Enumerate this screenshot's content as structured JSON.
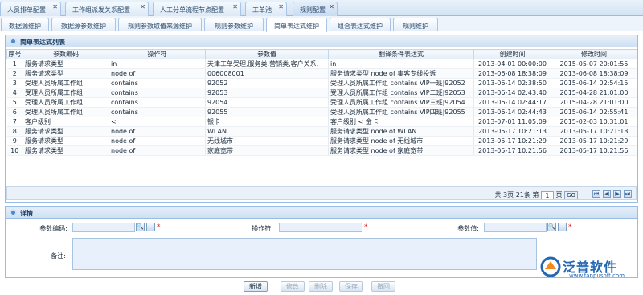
{
  "top_tabs": [
    {
      "label": "人员排单配置"
    },
    {
      "label": "工作组派发关系配置"
    },
    {
      "label": "人工分单流程节点配置"
    },
    {
      "label": "工单池"
    },
    {
      "label": "规则配置"
    }
  ],
  "sub_tabs": [
    {
      "label": "数据源维护"
    },
    {
      "label": "数据源参数维护"
    },
    {
      "label": "规则参数取值来源维护"
    },
    {
      "label": "规则参数维护"
    },
    {
      "label": "简单表达式维护"
    },
    {
      "label": "组合表达式维护"
    },
    {
      "label": "规则维护"
    }
  ],
  "list_panel": {
    "title": "简单表达式列表"
  },
  "table": {
    "columns": [
      "序号",
      "参数编码",
      "操作符",
      "参数值",
      "翻译条件表达式",
      "创建时间",
      "修改时间"
    ],
    "rows": [
      [
        "1",
        "服务请求类型",
        "in",
        "天津工单受理,服务类,营销类,客户关系,",
        "in",
        "2013-04-01 00:00:00",
        "2015-05-07 20:01:55"
      ],
      [
        "2",
        "服务请求类型",
        "node of",
        "006008001",
        "服务请求类型 node of 集客专线投诉",
        "2013-06-08 18:38:09",
        "2013-06-08 18:38:09"
      ],
      [
        "3",
        "受理人员所属工作组",
        "contains",
        "92052",
        "受理人员所属工作组 contains VIP一班|92052",
        "2013-06-14 02:38:50",
        "2015-06-14 02:54:15"
      ],
      [
        "4",
        "受理人员所属工作组",
        "contains",
        "92053",
        "受理人员所属工作组 contains VIP二班|92053",
        "2013-06-14 02:43:40",
        "2015-04-28 21:01:00"
      ],
      [
        "5",
        "受理人员所属工作组",
        "contains",
        "92054",
        "受理人员所属工作组 contains VIP三班|92054",
        "2013-06-14 02:44:17",
        "2015-04-28 21:01:00"
      ],
      [
        "6",
        "受理人员所属工作组",
        "contains",
        "92055",
        "受理人员所属工作组 contains VIP四班|92055",
        "2013-06-14 02:44:43",
        "2015-06-14 02:55:41"
      ],
      [
        "7",
        "客户级别",
        "<",
        "银卡",
        "客户级别 < 金卡",
        "2013-07-01 11:05:09",
        "2015-02-03 10:31:01"
      ],
      [
        "8",
        "服务请求类型",
        "node of",
        "WLAN",
        "服务请求类型 node of WLAN",
        "2013-05-17 10:21:13",
        "2013-05-17 10:21:13"
      ],
      [
        "9",
        "服务请求类型",
        "node of",
        "无线城市",
        "服务请求类型 node of 无线城市",
        "2013-05-17 10:21:29",
        "2013-05-17 10:21:29"
      ],
      [
        "10",
        "服务请求类型",
        "node of",
        "家庭宽带",
        "服务请求类型 node of 家庭宽带",
        "2013-05-17 10:21:56",
        "2013-05-17 10:21:56"
      ]
    ]
  },
  "pager": {
    "text_prefix": "共 3页 21条 第",
    "page_value": "1",
    "text_suffix": "页",
    "go_label": "GO"
  },
  "detail_panel": {
    "title": "详情"
  },
  "form": {
    "param_code_label": "参数编码:",
    "operator_label": "操作符:",
    "param_value_label": "参数值:",
    "remark_label": "备注:",
    "required_mark": "*"
  },
  "actions": {
    "new": "新增",
    "edit": "修改",
    "delete": "删除",
    "save": "保存",
    "cancel": "撤回"
  },
  "logo": {
    "text": "泛普软件",
    "url": "www.fanpusoft.com"
  },
  "colors": {
    "header_blue": "#d3e3f3",
    "border_blue": "#99bbe8",
    "field_bg": "#e8f1fb",
    "required": "#e02020",
    "logo_blue": "#2467b3"
  }
}
